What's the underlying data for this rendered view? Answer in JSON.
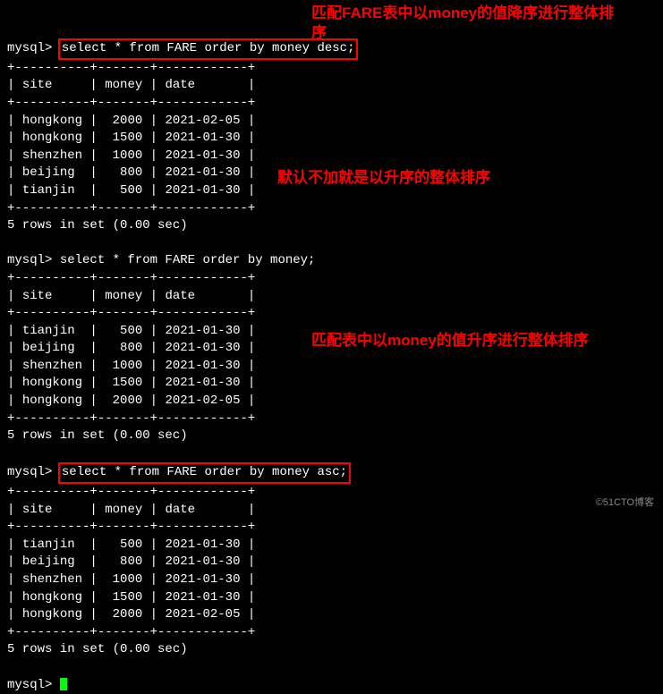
{
  "queries": {
    "q1": {
      "prompt": "mysql> ",
      "command": "select * from FARE order by money desc;",
      "annotation": "匹配FARE表中以money的值降序进行整体排序",
      "headers": {
        "site": "site",
        "money": "money",
        "date": "date"
      },
      "rows": [
        {
          "site": "hongkong",
          "money": "2000",
          "date": "2021-02-05"
        },
        {
          "site": "hongkong",
          "money": "1500",
          "date": "2021-01-30"
        },
        {
          "site": "shenzhen",
          "money": "1000",
          "date": "2021-01-30"
        },
        {
          "site": "beijing",
          "money": "800",
          "date": "2021-01-30"
        },
        {
          "site": "tianjin",
          "money": "500",
          "date": "2021-01-30"
        }
      ],
      "status": "5 rows in set (0.00 sec)"
    },
    "q2": {
      "prompt": "mysql> ",
      "command": "select * from FARE order by money;",
      "annotation": "默认不加就是以升序的整体排序",
      "headers": {
        "site": "site",
        "money": "money",
        "date": "date"
      },
      "rows": [
        {
          "site": "tianjin",
          "money": "500",
          "date": "2021-01-30"
        },
        {
          "site": "beijing",
          "money": "800",
          "date": "2021-01-30"
        },
        {
          "site": "shenzhen",
          "money": "1000",
          "date": "2021-01-30"
        },
        {
          "site": "hongkong",
          "money": "1500",
          "date": "2021-01-30"
        },
        {
          "site": "hongkong",
          "money": "2000",
          "date": "2021-02-05"
        }
      ],
      "status": "5 rows in set (0.00 sec)"
    },
    "q3": {
      "prompt": "mysql> ",
      "command": "select * from FARE order by money asc;",
      "annotation": "匹配表中以money的值升序进行整体排序",
      "headers": {
        "site": "site",
        "money": "money",
        "date": "date"
      },
      "rows": [
        {
          "site": "tianjin",
          "money": "500",
          "date": "2021-01-30"
        },
        {
          "site": "beijing",
          "money": "800",
          "date": "2021-01-30"
        },
        {
          "site": "shenzhen",
          "money": "1000",
          "date": "2021-01-30"
        },
        {
          "site": "hongkong",
          "money": "1500",
          "date": "2021-01-30"
        },
        {
          "site": "hongkong",
          "money": "2000",
          "date": "2021-02-05"
        }
      ],
      "status": "5 rows in set (0.00 sec)"
    }
  },
  "final_prompt": "mysql> ",
  "separator": "+----------+-------+------------+",
  "watermark": "©51CTO博客"
}
